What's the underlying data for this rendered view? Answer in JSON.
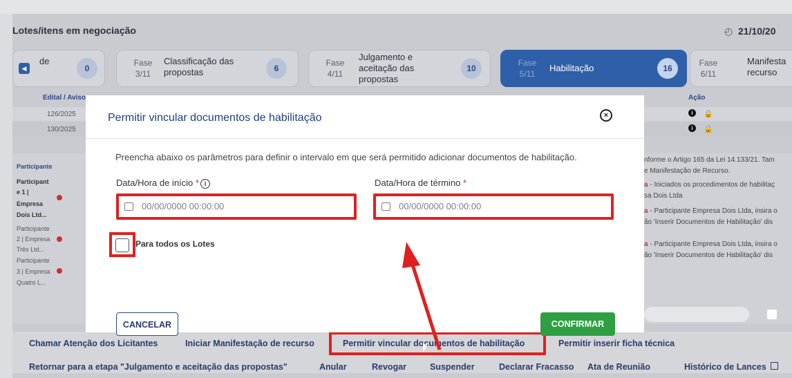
{
  "header": {
    "title": "Lotes/itens em negociação",
    "date": "21/10/20"
  },
  "phases": [
    {
      "fase": "",
      "name": "de",
      "count": "0"
    },
    {
      "fase": "Fase 3/11",
      "name": "Classificação das propostas",
      "count": "6"
    },
    {
      "fase": "Fase 4/11",
      "name": "Julgamento e aceitação das propostas",
      "count": "10"
    },
    {
      "fase": "Fase 5/11",
      "name": "Habilitação",
      "count": "16"
    },
    {
      "fase": "Fase 6/11",
      "name": "Manifesta recurso",
      "count": ""
    }
  ],
  "table": {
    "headers": {
      "edital": "Edital / Aviso",
      "acao": "Ação"
    },
    "rows": [
      {
        "edital": "126/2025"
      },
      {
        "edital": "130/2025"
      }
    ]
  },
  "left_panel": {
    "header": "Participante",
    "items": [
      "Participant",
      "e 1 |",
      "Empresa",
      "Dois Ltd...",
      "Participante",
      "2 | Empresa",
      "Três Ltd...",
      "Participante",
      "3 | Empresa",
      "Quatro L..."
    ]
  },
  "right_panel": {
    "lines": [
      {
        "prefix": "",
        "text": "nforme o Artigo 165 da Lei 14.133/21. Tam"
      },
      {
        "prefix": "",
        "text": "e Manifestação de Recurso."
      },
      {
        "prefix": "a",
        "text": " - Iniciados os procedimentos de habilitaç"
      },
      {
        "prefix": "",
        "text": "sa Dois Ltda"
      },
      {
        "prefix": "a",
        "text": " - Participante Empresa Dois Ltda, insira o"
      },
      {
        "prefix": "",
        "text": "ão 'Inserir Documentos de Habilitação' dis"
      },
      {
        "prefix": "a",
        "text": " - Participante Empresa Dois Ltda, insira o"
      },
      {
        "prefix": "",
        "text": "ão 'Inserir Documentos de Habilitação' dis"
      }
    ]
  },
  "modal": {
    "title": "Permitir vincular documentos de habilitação",
    "description": "Preencha abaixo os parâmetros para definir o intervalo em que será permitido adicionar documentos de habilitação.",
    "start_label": "Data/Hora de início",
    "end_label": "Data/Hora de término",
    "start_placeholder": "00/00/0000 00:00:00",
    "end_placeholder": "00/00/0000 00:00:00",
    "checkbox_label": "Para todos os Lotes",
    "cancel_label": "CANCELAR",
    "confirm_label": "CONFIRMAR"
  },
  "bottom_row1": [
    "Chamar Atenção dos Licitantes",
    "Iniciar Manifestação de recurso",
    "Permitir vincular documentos de habilitação",
    "Permitir inserir ficha técnica"
  ],
  "bottom_row2": [
    "Retornar para a etapa \"Julgamento e aceitação das propostas\"",
    "Anular",
    "Revogar",
    "Suspender",
    "Declarar Fracasso",
    "Ata de Reunião",
    "Histórico de Lances"
  ],
  "colors": {
    "accent": "#2f5fa8",
    "danger": "#e0201e",
    "confirm": "#2ea043"
  }
}
